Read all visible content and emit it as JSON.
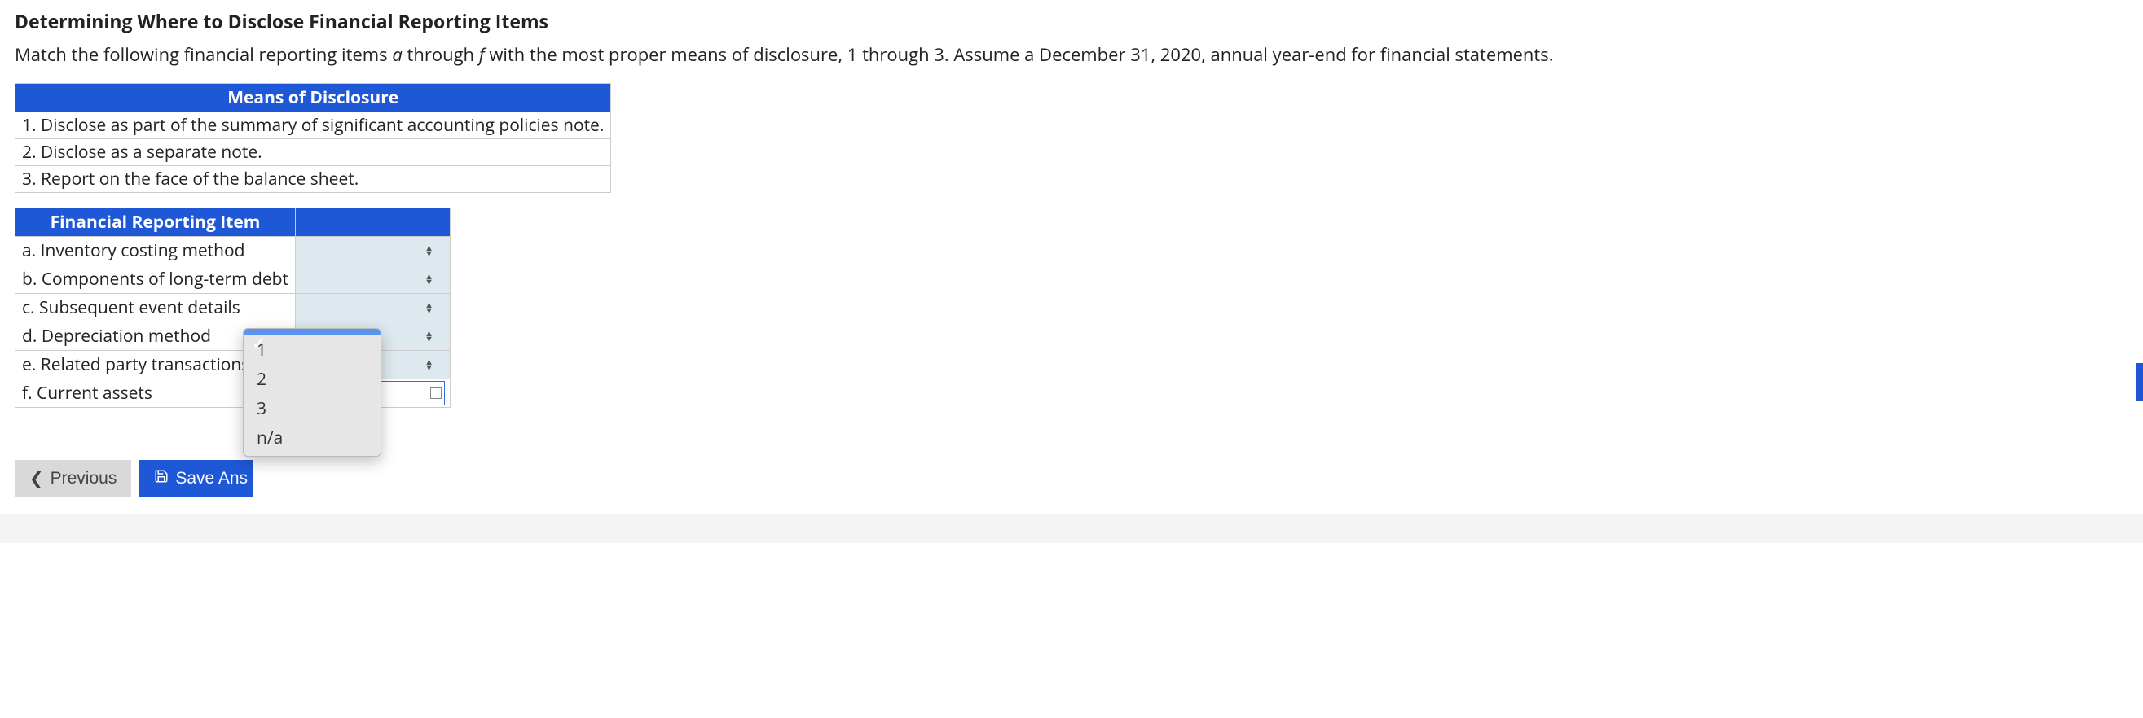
{
  "title": "Determining Where to Disclose Financial Reporting Items",
  "instructions": {
    "pre": "Match the following financial reporting items ",
    "range1": "a",
    "mid1": " through ",
    "range2": "f",
    "post": " with the most proper means of disclosure, 1 through 3. Assume a December 31, 2020, annual year-end for financial statements."
  },
  "means_table": {
    "header": "Means of Disclosure",
    "rows": [
      "1. Disclose as part of the summary of significant accounting policies note.",
      "2. Disclose as a separate note.",
      "3. Report on the face of the balance sheet."
    ]
  },
  "items_table": {
    "header": "Financial Reporting Item",
    "rows": [
      "a. Inventory costing method",
      "b. Components of long-term debt",
      "c. Subsequent event details",
      "d. Depreciation method",
      "e. Related party transactions",
      "f. Current assets"
    ]
  },
  "dropdown": {
    "selected_glyph": "✓",
    "options": [
      "1",
      "2",
      "3",
      "n/a"
    ]
  },
  "buttons": {
    "previous": "Previous",
    "save": "Save Ans"
  },
  "icons": {
    "chevron_left": "❮",
    "save_disk": "💾",
    "sort_up": "▲",
    "sort_down": "▼"
  }
}
